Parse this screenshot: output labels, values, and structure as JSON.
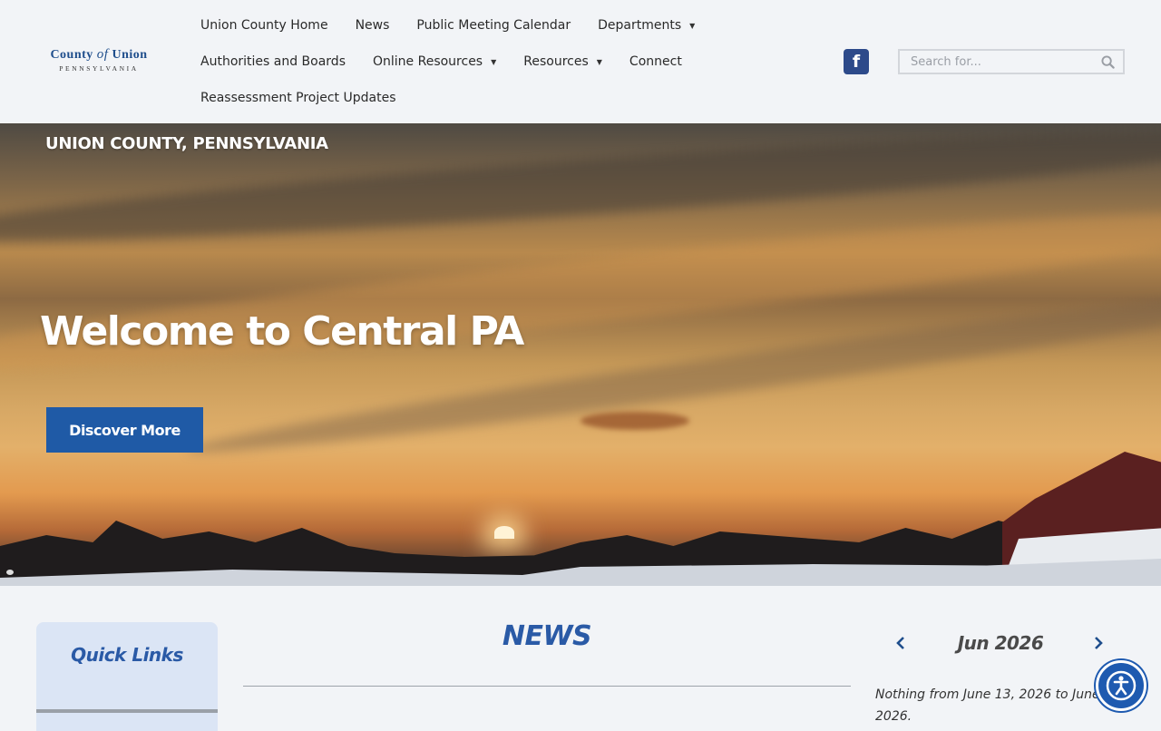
{
  "header": {
    "logo": {
      "line1_a": "County",
      "line1_of": "of",
      "line1_b": "Union",
      "line2": "PENNSYLVANIA"
    },
    "nav_rows": [
      [
        {
          "label": "Union County Home",
          "dropdown": false
        },
        {
          "label": "News",
          "dropdown": false
        },
        {
          "label": "Public Meeting Calendar",
          "dropdown": false
        },
        {
          "label": "Departments",
          "dropdown": true
        }
      ],
      [
        {
          "label": "Authorities and Boards",
          "dropdown": false
        },
        {
          "label": "Online Resources",
          "dropdown": true
        },
        {
          "label": "Resources",
          "dropdown": true
        },
        {
          "label": "Connect",
          "dropdown": false
        }
      ],
      [
        {
          "label": "Reassessment Project Updates",
          "dropdown": false
        }
      ]
    ],
    "social": {
      "icon": "facebook-icon",
      "glyph": "f"
    },
    "search": {
      "placeholder": "Search for...",
      "value": ""
    }
  },
  "hero": {
    "subtitle": "UNION COUNTY, PENNSYLVANIA",
    "title": "Welcome to Central PA",
    "button_label": "Discover More"
  },
  "quick_links": {
    "title": "Quick Links"
  },
  "news": {
    "title": "NEWS"
  },
  "calendar": {
    "month": "Jun 2026",
    "empty_message": "Nothing from June 13, 2026 to June 2026."
  },
  "colors": {
    "brand_blue": "#1f5aa6",
    "link_blue": "#2a5aa6",
    "facebook": "#2d4a8a",
    "panel": "#dbe5f5",
    "background": "#f2f4f7"
  }
}
